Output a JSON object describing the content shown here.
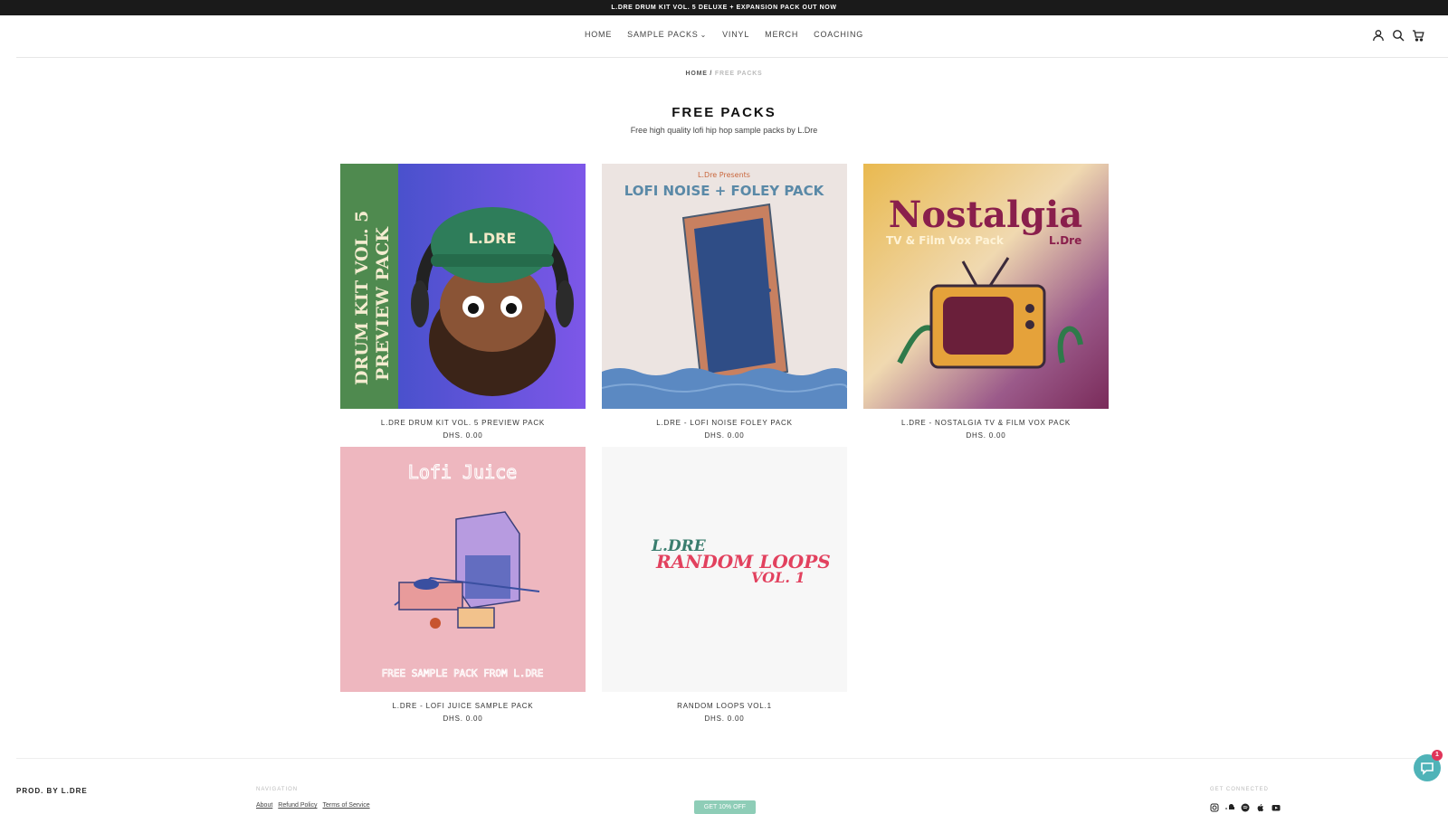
{
  "announcement": "L.DRE DRUM KIT VOL. 5 DELUXE + EXPANSION PACK OUT NOW",
  "nav": {
    "items": [
      {
        "label": "HOME"
      },
      {
        "label": "SAMPLE PACKS",
        "has_dropdown": true
      },
      {
        "label": "VINYL"
      },
      {
        "label": "MERCH"
      },
      {
        "label": "COACHING"
      }
    ],
    "icons": [
      "account-icon",
      "search-icon",
      "cart-icon"
    ]
  },
  "breadcrumb": {
    "home": "HOME",
    "separator": "/",
    "current": "FREE PACKS"
  },
  "page": {
    "title": "FREE PACKS",
    "subtitle": "Free high quality lofi hip hop sample packs by L.Dre"
  },
  "products": [
    {
      "title": "L.DRE DRUM KIT VOL. 5 PREVIEW PACK",
      "price": "DHS. 0.00",
      "art": "drum-kit",
      "art_text": [
        "DRUM KIT VOL. 5",
        "PREVIEW PACK",
        "L.DRE"
      ]
    },
    {
      "title": "L.DRE - LOFI NOISE FOLEY PACK",
      "price": "DHS. 0.00",
      "art": "foley",
      "art_text": [
        "L.Dre Presents",
        "LOFI NOISE + FOLEY PACK"
      ]
    },
    {
      "title": "L.DRE - NOSTALGIA TV & FILM VOX PACK",
      "price": "DHS. 0.00",
      "art": "nostalgia",
      "art_text": [
        "Nostalgia",
        "TV & Film Vox Pack",
        "L.Dre"
      ]
    },
    {
      "title": "L.DRE - LOFI JUICE SAMPLE PACK",
      "price": "DHS. 0.00",
      "art": "juice",
      "art_text": [
        "Lofi Juice",
        "FREE SAMPLE PACK FROM L.DRE"
      ]
    },
    {
      "title": "RANDOM LOOPS VOL.1",
      "price": "DHS. 0.00",
      "art": "random",
      "art_text": [
        "L.DRE",
        "RANDOM LOOPS",
        "VOL. 1"
      ]
    }
  ],
  "footer": {
    "brand": "PROD. BY L.DRE",
    "navigation_heading": "NAVIGATION",
    "links": [
      "About",
      "Refund Policy",
      "Terms of Service"
    ],
    "button_label": "GET 10% OFF",
    "connected_heading": "GET CONNECTED",
    "socials": [
      "instagram-icon",
      "soundcloud-icon",
      "spotify-icon",
      "apple-icon",
      "youtube-icon"
    ]
  },
  "chat": {
    "badge": "1"
  },
  "colors": {
    "accent": "#8ecdb7",
    "badge": "#e0355a",
    "chat": "#4fb3b8"
  }
}
